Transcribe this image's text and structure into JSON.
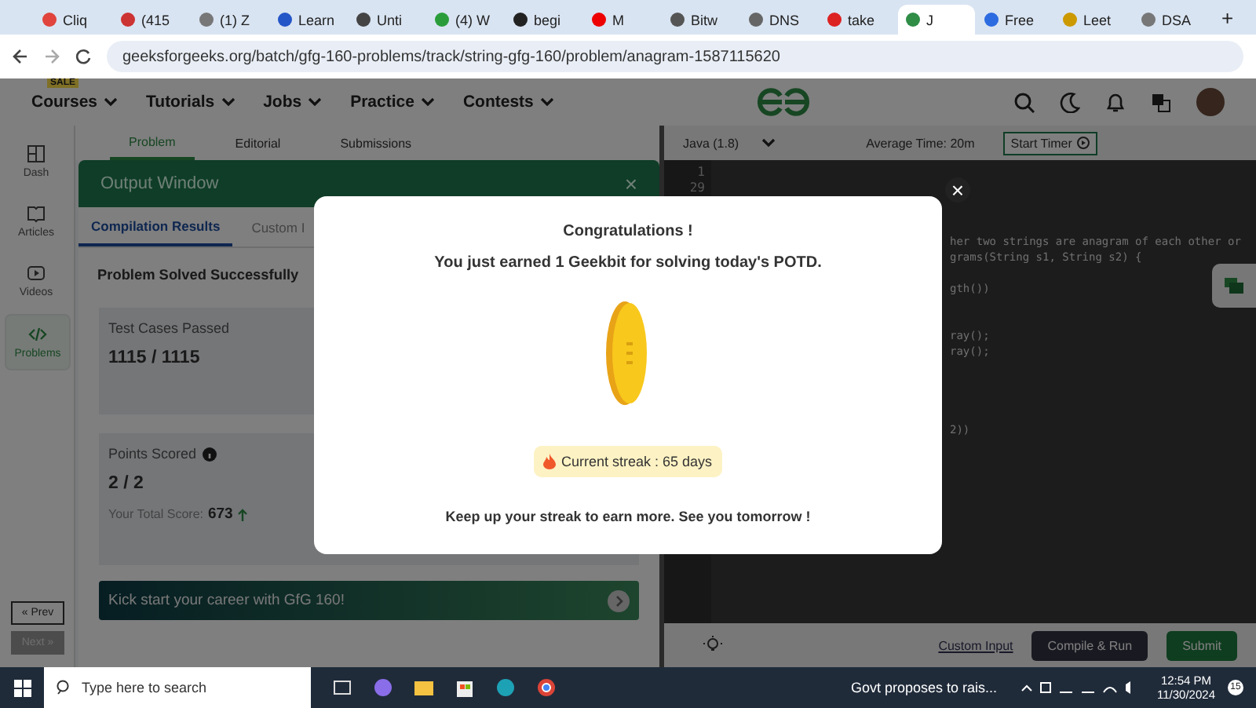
{
  "browser": {
    "tabs": [
      {
        "label": "Cliq",
        "selected": false
      },
      {
        "label": "(415",
        "selected": false
      },
      {
        "label": "(1) Z",
        "selected": false
      },
      {
        "label": "Learn",
        "selected": false
      },
      {
        "label": "Unti",
        "selected": false
      },
      {
        "label": "(4) W",
        "selected": false
      },
      {
        "label": "begi",
        "selected": false
      },
      {
        "label": "M",
        "selected": false
      },
      {
        "label": "Bitw",
        "selected": false
      },
      {
        "label": "DNS",
        "selected": false
      },
      {
        "label": "take",
        "selected": false
      },
      {
        "label": "J",
        "selected": true
      },
      {
        "label": "Free",
        "selected": false
      },
      {
        "label": "Leet",
        "selected": false
      },
      {
        "label": "DSA",
        "selected": false
      }
    ],
    "new_tab": "+",
    "url": "geeksforgeeks.org/batch/gfg-160-problems/track/string-gfg-160/problem/anagram-1587115620"
  },
  "site_nav": {
    "menu": [
      {
        "label": "Courses",
        "badge": "SALE"
      },
      {
        "label": "Tutorials"
      },
      {
        "label": "Jobs"
      },
      {
        "label": "Practice"
      },
      {
        "label": "Contests"
      }
    ]
  },
  "sidebar": {
    "items": [
      {
        "label": "Dash",
        "selected": false
      },
      {
        "label": "Articles",
        "selected": false
      },
      {
        "label": "Videos",
        "selected": false
      },
      {
        "label": "Problems",
        "selected": true
      }
    ],
    "prev": "« Prev",
    "next": "Next »"
  },
  "problem_tabs": [
    {
      "label": "Problem",
      "selected": true
    },
    {
      "label": "Editorial",
      "selected": false
    },
    {
      "label": "Submissions",
      "selected": false
    }
  ],
  "output_window": {
    "title": "Output Window",
    "close": "×",
    "tabs": [
      {
        "label": "Compilation Results",
        "selected": true
      },
      {
        "label": "Custom I",
        "selected": false
      }
    ],
    "status": "Problem Solved Successfully",
    "tests_label": "Test Cases Passed",
    "tests_value": "1115 / 1115",
    "points_label": "Points Scored",
    "points_value": "2 / 2",
    "total_label": "Your Total Score:",
    "total_value": "673",
    "banner": "Kick start your career with GfG 160!"
  },
  "editor": {
    "language": "Java (1.8)",
    "average_time": "Average Time: 20m",
    "timer_button": "Start Timer",
    "line_numbers": [
      "1",
      "29"
    ],
    "code_fragments": [
      "her two strings are anagram of each other or",
      "grams(String s1, String s2) {",
      "gth())",
      "ray();",
      "ray();",
      "2))"
    ],
    "custom_input": "Custom Input",
    "compile_button": "Compile & Run",
    "submit_button": "Submit"
  },
  "modal": {
    "title": "Congratulations !",
    "message": "You just earned 1 Geekbit for solving today's POTD.",
    "streak": "Current streak : 65 days",
    "footer": "Keep up your streak to earn more. See you tomorrow !",
    "close": "×"
  },
  "taskbar": {
    "search_placeholder": "Type here to search",
    "news": "Govt proposes to rais...",
    "time": "12:54 PM",
    "date": "11/30/2024",
    "notifications": "15"
  }
}
